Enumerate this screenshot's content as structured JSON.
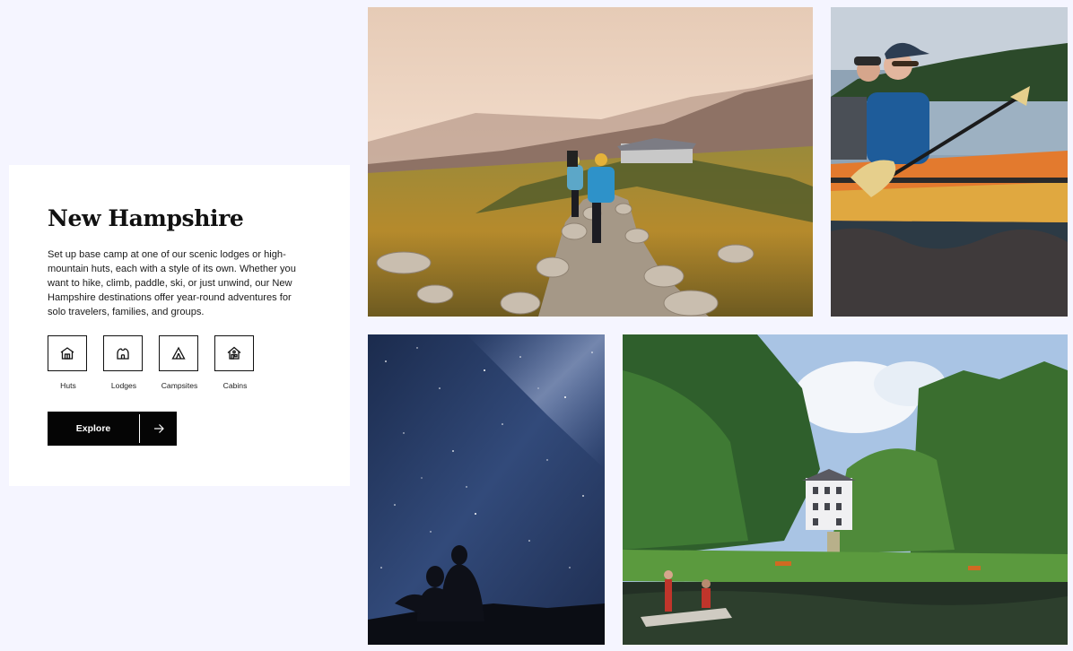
{
  "destination": {
    "title": "New Hampshire",
    "description": "Set up base camp at one of our scenic lodges or high-mountain huts, each with a style of its own. Whether you want to hike, climb, paddle, ski, or just unwind, our New Hampshire destinations offer year-round adventures for solo travelers, families, and groups.",
    "lodging_types": [
      {
        "label": "Huts",
        "icon": "hut-icon"
      },
      {
        "label": "Lodges",
        "icon": "lodge-icon"
      },
      {
        "label": "Campsites",
        "icon": "tent-icon"
      },
      {
        "label": "Cabins",
        "icon": "cabin-icon"
      }
    ],
    "cta": {
      "label": "Explore",
      "icon": "arrow-right-icon"
    }
  },
  "colors": {
    "background": "#f5f5ff",
    "card": "#ffffff",
    "button": "#050505"
  }
}
